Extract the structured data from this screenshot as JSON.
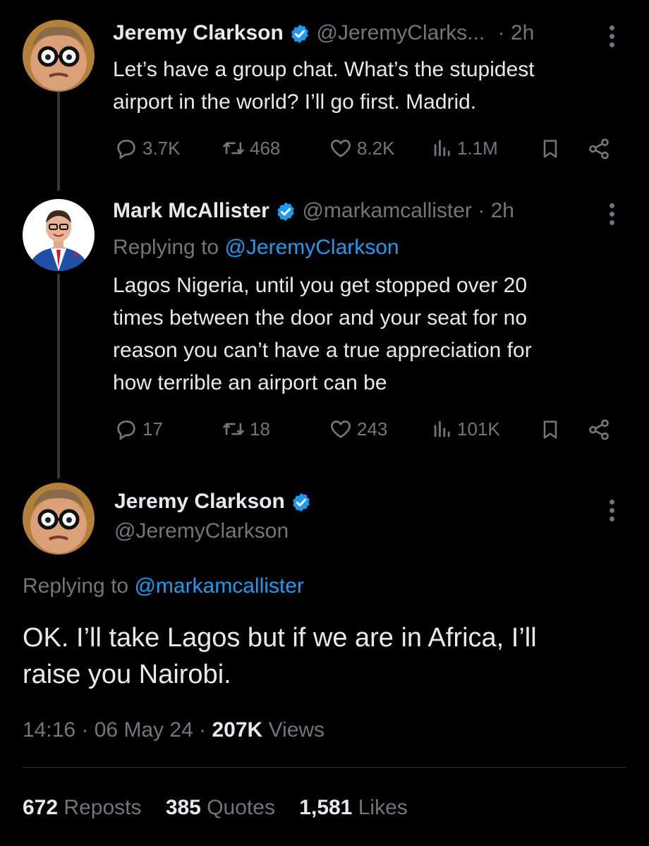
{
  "tweet1": {
    "name": "Jeremy Clarkson",
    "handle": "@JeremyClarks...",
    "time": "· 2h",
    "text_line1": "Let’s have a group chat. What’s the stupidest",
    "text_line2": "airport in the world? I’ll go first. Madrid.",
    "replies": "3.7K",
    "reposts": "468",
    "likes": "8.2K",
    "views": "1.1M"
  },
  "tweet2": {
    "name": "Mark McAllister",
    "handle": "@markamcallister",
    "time": "· 2h",
    "replying_prefix": "Replying to",
    "replying_handle": "@JeremyClarkson",
    "text_line1": "Lagos Nigeria, until you get stopped over 20",
    "text_line2": "times between the door and your seat for no",
    "text_line3": "reason you can’t have a true appreciation for",
    "text_line4": "how terrible an airport can be",
    "replies": "17",
    "reposts": "18",
    "likes": "243",
    "views": "101K"
  },
  "main": {
    "name": "Jeremy Clarkson",
    "handle": "@JeremyClarkson",
    "replying_prefix": "Replying to",
    "replying_handle": "@markamcallister",
    "text_line1": "OK. I’ll take Lagos but if we are in Africa, I’ll",
    "text_line2": "raise you Nairobi.",
    "timestamp": "14:16 · 06 May 24 ·",
    "views_count": "207K",
    "views_label": "Views",
    "reposts_count": "672",
    "reposts_label": "Reposts",
    "quotes_count": "385",
    "quotes_label": "Quotes",
    "likes_count": "1,581",
    "likes_label": "Likes"
  },
  "colors": {
    "background": "#000000",
    "text": "#e7e9ea",
    "muted": "#71767b",
    "link": "#1d9bf0",
    "verified": "#1d9bf0"
  }
}
